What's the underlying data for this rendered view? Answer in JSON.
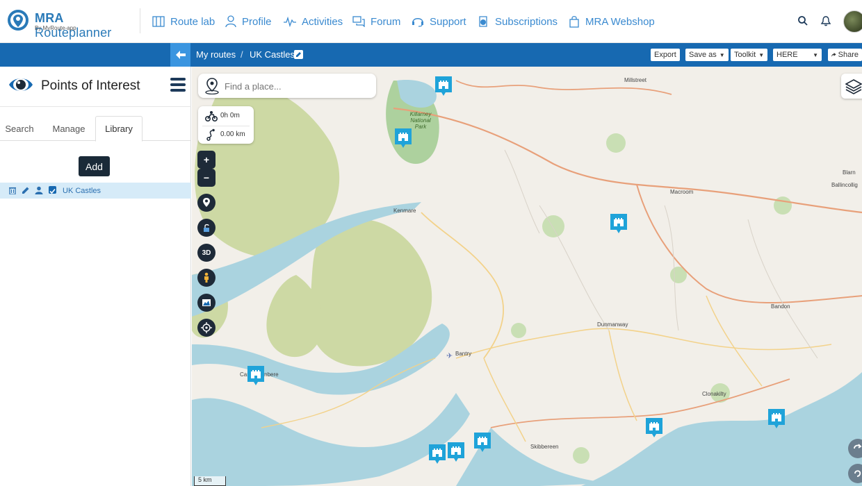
{
  "app": {
    "logo_title_bold": "MRA",
    "logo_title_rest": " Routeplanner",
    "logo_sub": "By MyRoute-app"
  },
  "nav": [
    {
      "label": "Route lab",
      "icon": "route-lab-icon"
    },
    {
      "label": "Profile",
      "icon": "profile-icon"
    },
    {
      "label": "Activities",
      "icon": "activities-icon"
    },
    {
      "label": "Forum",
      "icon": "forum-icon"
    },
    {
      "label": "Support",
      "icon": "support-icon"
    },
    {
      "label": "Subscriptions",
      "icon": "subscriptions-icon"
    },
    {
      "label": "MRA Webshop",
      "icon": "webshop-icon"
    }
  ],
  "breadcrumb": {
    "root": "My routes",
    "separator": "/",
    "current": "UK Castles"
  },
  "toolbar": {
    "export": "Export",
    "save_as": "Save as",
    "toolkit": "Toolkit",
    "map_provider": "HERE",
    "share": "Share"
  },
  "panel": {
    "title": "Points of Interest",
    "tabs": [
      "Search",
      "Manage",
      "Library"
    ],
    "active_tab": "Library",
    "add_button": "Add",
    "library_items": [
      {
        "name": "UK Castles",
        "checked": true
      }
    ]
  },
  "map": {
    "search_placeholder": "Find a place...",
    "duration": "0h 0m",
    "distance": "0.00 km",
    "scale_label": "5 km",
    "zoom_in": "+",
    "zoom_out": "−",
    "three_d": "3D",
    "places": [
      "Millstreet",
      "Killarney National Park",
      "Kenmare",
      "Macroom",
      "Ballincollig",
      "Blarn",
      "Bandon",
      "Dunmanway",
      "Bantry",
      "Castletownbere",
      "Clonakilty",
      "Skibbereen"
    ],
    "colors": {
      "water": "#aad3df",
      "land": "#f2efe9",
      "park": "#cdd9a4",
      "forest": "#add19e",
      "road_major": "#e8a07a",
      "road_minor": "#f3d28a",
      "marker": "#1fa3d9"
    }
  }
}
